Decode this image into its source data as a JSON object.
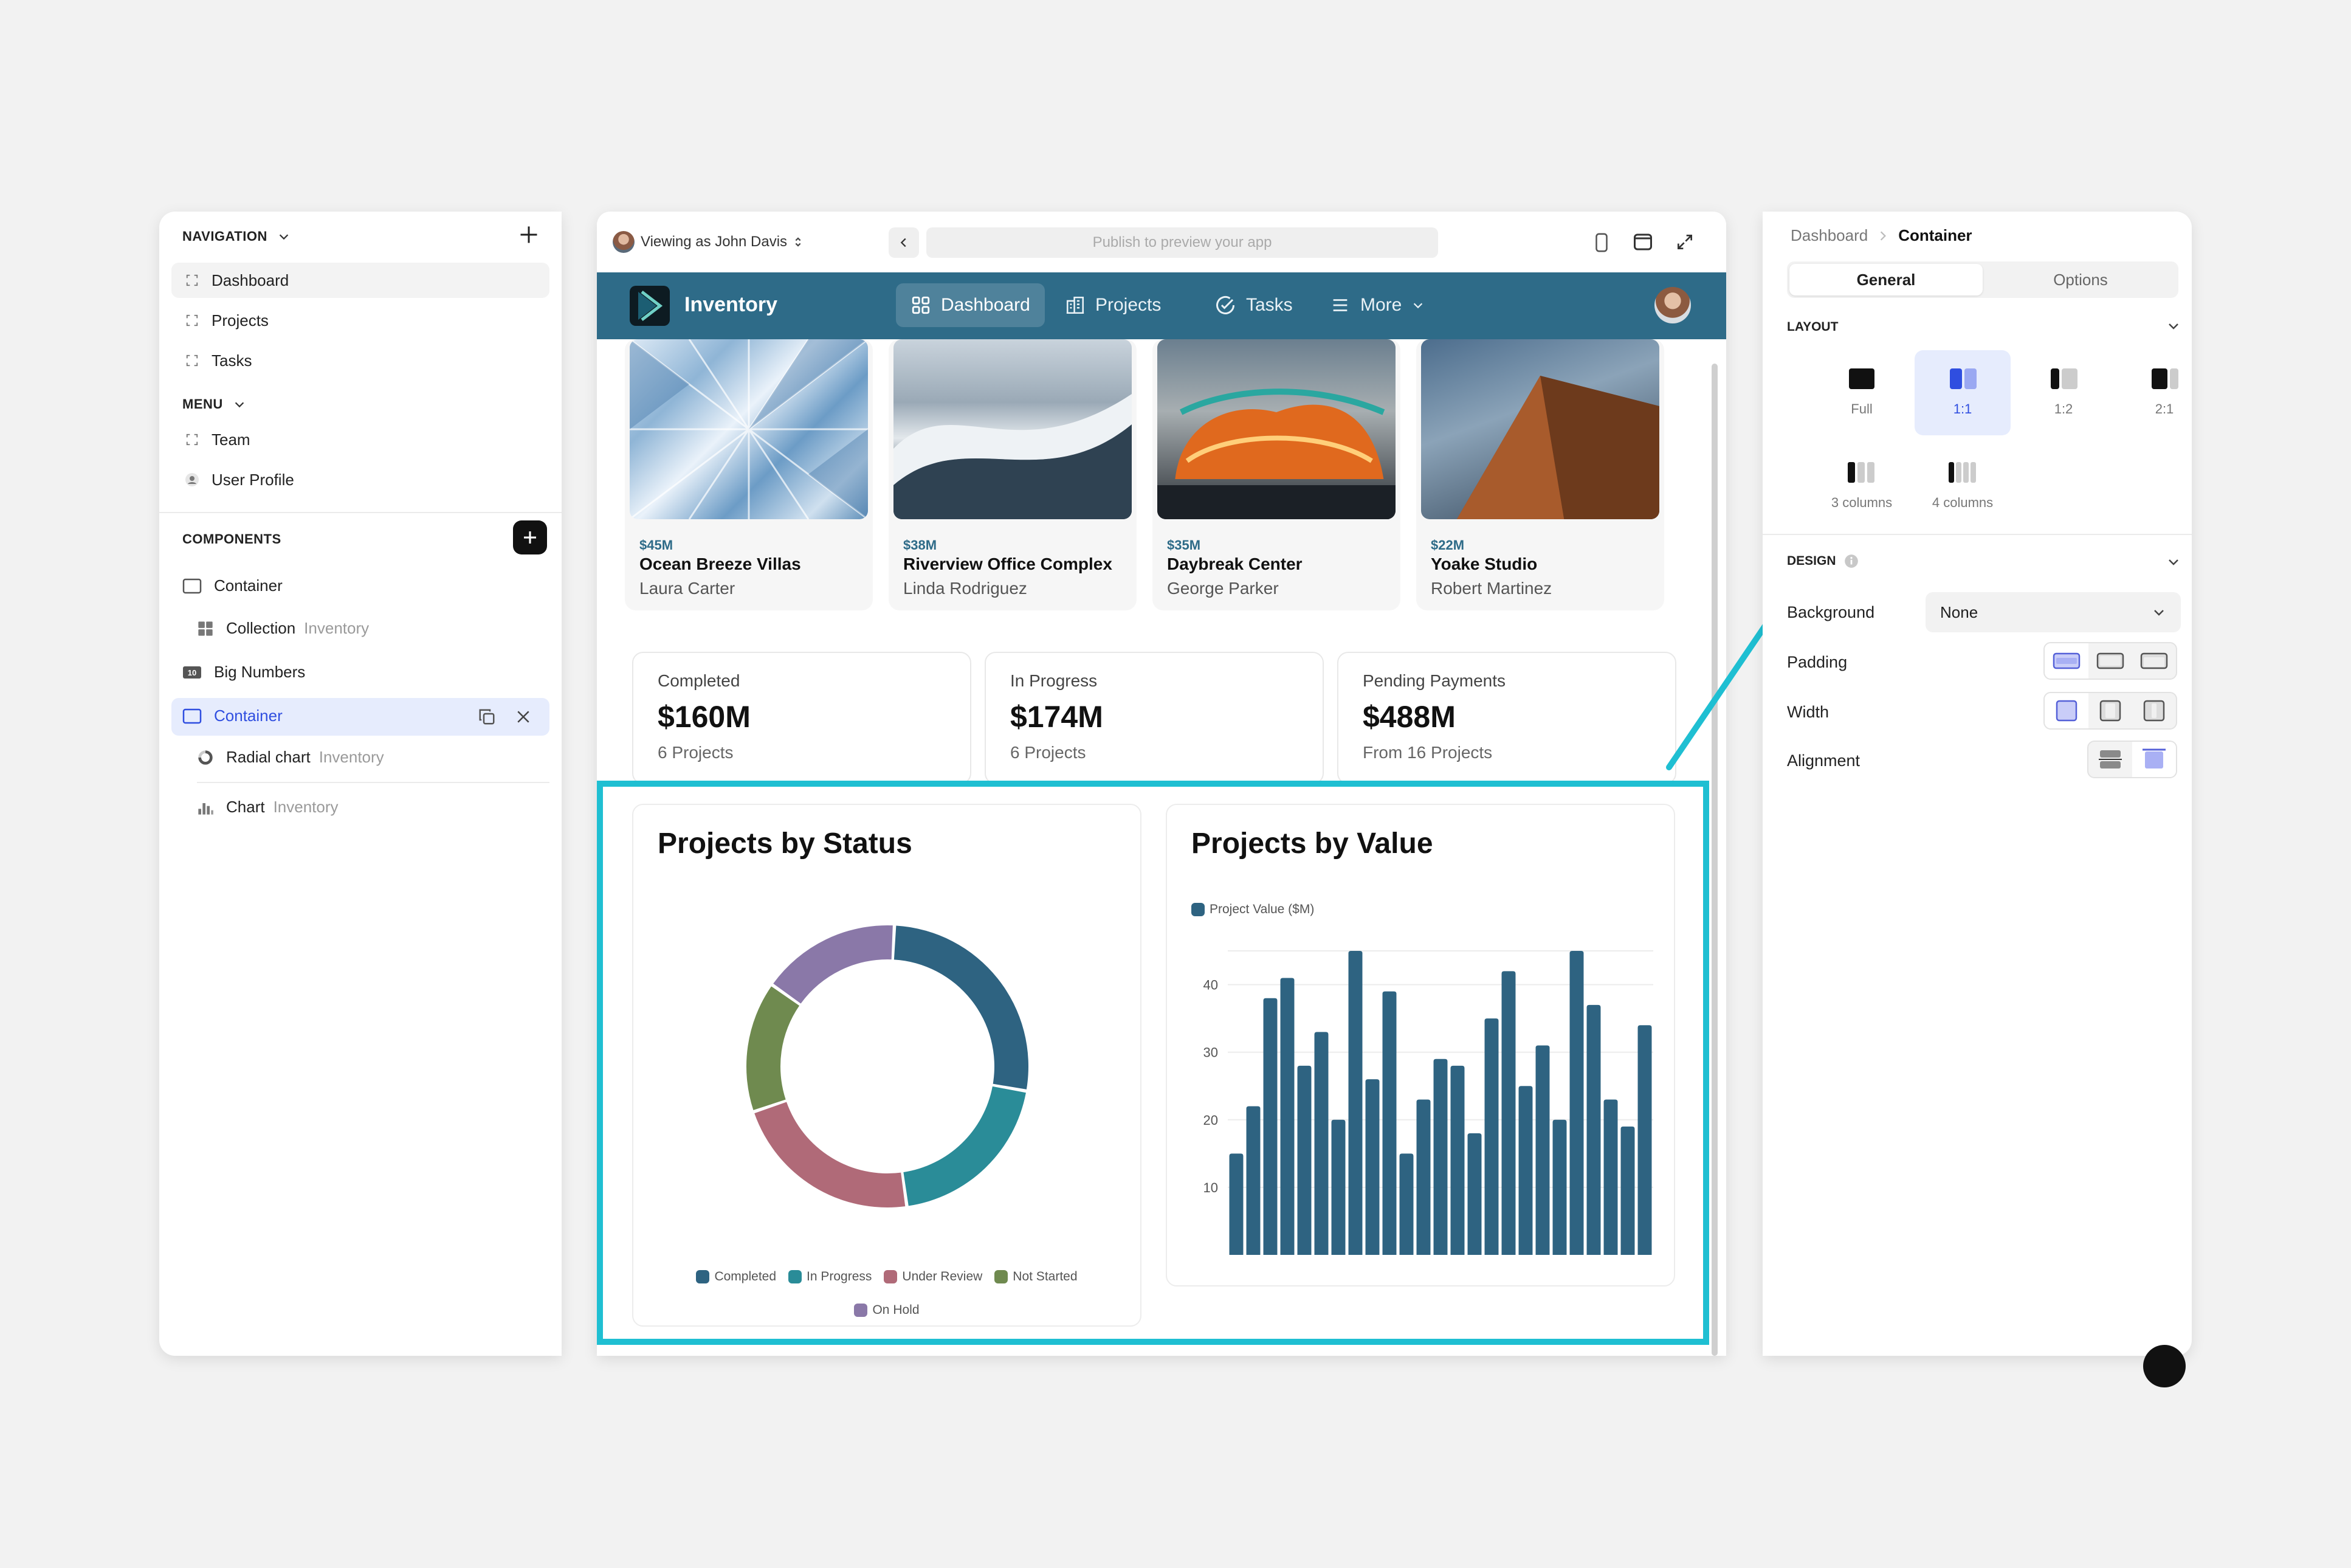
{
  "left": {
    "navigation_heading": "NAVIGATION",
    "nav_items": [
      {
        "label": "Dashboard",
        "icon": "page-icon"
      },
      {
        "label": "Projects",
        "icon": "page-icon"
      },
      {
        "label": "Tasks",
        "icon": "page-icon"
      }
    ],
    "menu_heading": "MENU",
    "menu_items": [
      {
        "label": "Team",
        "icon": "page-icon"
      },
      {
        "label": "User Profile",
        "icon": "user-icon"
      }
    ],
    "components_heading": "COMPONENTS",
    "components": [
      {
        "label": "Container",
        "sub": ""
      },
      {
        "label": "Collection",
        "sub": "Inventory"
      },
      {
        "label": "Big Numbers",
        "sub": ""
      },
      {
        "label": "Container",
        "sub": ""
      },
      {
        "label": "Radial chart",
        "sub": "Inventory"
      },
      {
        "label": "Chart",
        "sub": "Inventory"
      }
    ]
  },
  "browser": {
    "viewing_as": "Viewing as John Davis",
    "url_placeholder": "Publish to preview your app"
  },
  "app": {
    "name": "Inventory",
    "tabs": [
      "Dashboard",
      "Projects",
      "Tasks",
      "More"
    ],
    "active_tab": "Dashboard"
  },
  "projects": [
    {
      "price": "$45M",
      "name": "Ocean Breeze Villas",
      "person": "Laura Carter"
    },
    {
      "price": "$38M",
      "name": "Riverview Office Complex",
      "person": "Linda Rodriguez"
    },
    {
      "price": "$35M",
      "name": "Daybreak Center",
      "person": "George Parker"
    },
    {
      "price": "$22M",
      "name": "Yoake Studio",
      "person": "Robert Martinez"
    }
  ],
  "stats": [
    {
      "label": "Completed",
      "value": "$160M",
      "sub": "6 Projects"
    },
    {
      "label": "In Progress",
      "value": "$174M",
      "sub": "6 Projects"
    },
    {
      "label": "Pending Payments",
      "value": "$488M",
      "sub": "From 16 Projects"
    }
  ],
  "charts": {
    "status_title": "Projects by Status",
    "value_title": "Projects by Value"
  },
  "chart_data": [
    {
      "type": "pie",
      "title": "Projects by Status",
      "categories": [
        "Completed",
        "In Progress",
        "Under Review",
        "Not Started",
        "On Hold"
      ],
      "values": [
        27,
        20,
        22,
        15,
        16
      ],
      "colors": [
        "#2e6381",
        "#2a8c98",
        "#b06a78",
        "#6f8a4f",
        "#8a78a8"
      ]
    },
    {
      "type": "bar",
      "title": "Projects by Value",
      "series": [
        {
          "name": "Project Value ($M)",
          "values": [
            15,
            22,
            38,
            41,
            28,
            33,
            20,
            45,
            26,
            39,
            15,
            23,
            29,
            28,
            18,
            35,
            42,
            25,
            31,
            20,
            45,
            37,
            23,
            19,
            34
          ]
        }
      ],
      "ylim": [
        0,
        45
      ],
      "yticks": [
        10,
        20,
        30,
        40
      ],
      "color": "#2e6381",
      "xlabel": "",
      "ylabel": ""
    }
  ],
  "right": {
    "breadcrumb_parent": "Dashboard",
    "breadcrumb_current": "Container",
    "tabs": [
      "General",
      "Options"
    ],
    "layout_heading": "LAYOUT",
    "layout_options": [
      "Full",
      "1:1",
      "1:2",
      "2:1",
      "3 columns",
      "4 columns"
    ],
    "selected_layout": "1:1",
    "design_heading": "DESIGN",
    "background_label": "Background",
    "background_value": "None",
    "padding_label": "Padding",
    "width_label": "Width",
    "alignment_label": "Alignment"
  },
  "accent": "#1fbfd2",
  "brand": "#2e6b88"
}
